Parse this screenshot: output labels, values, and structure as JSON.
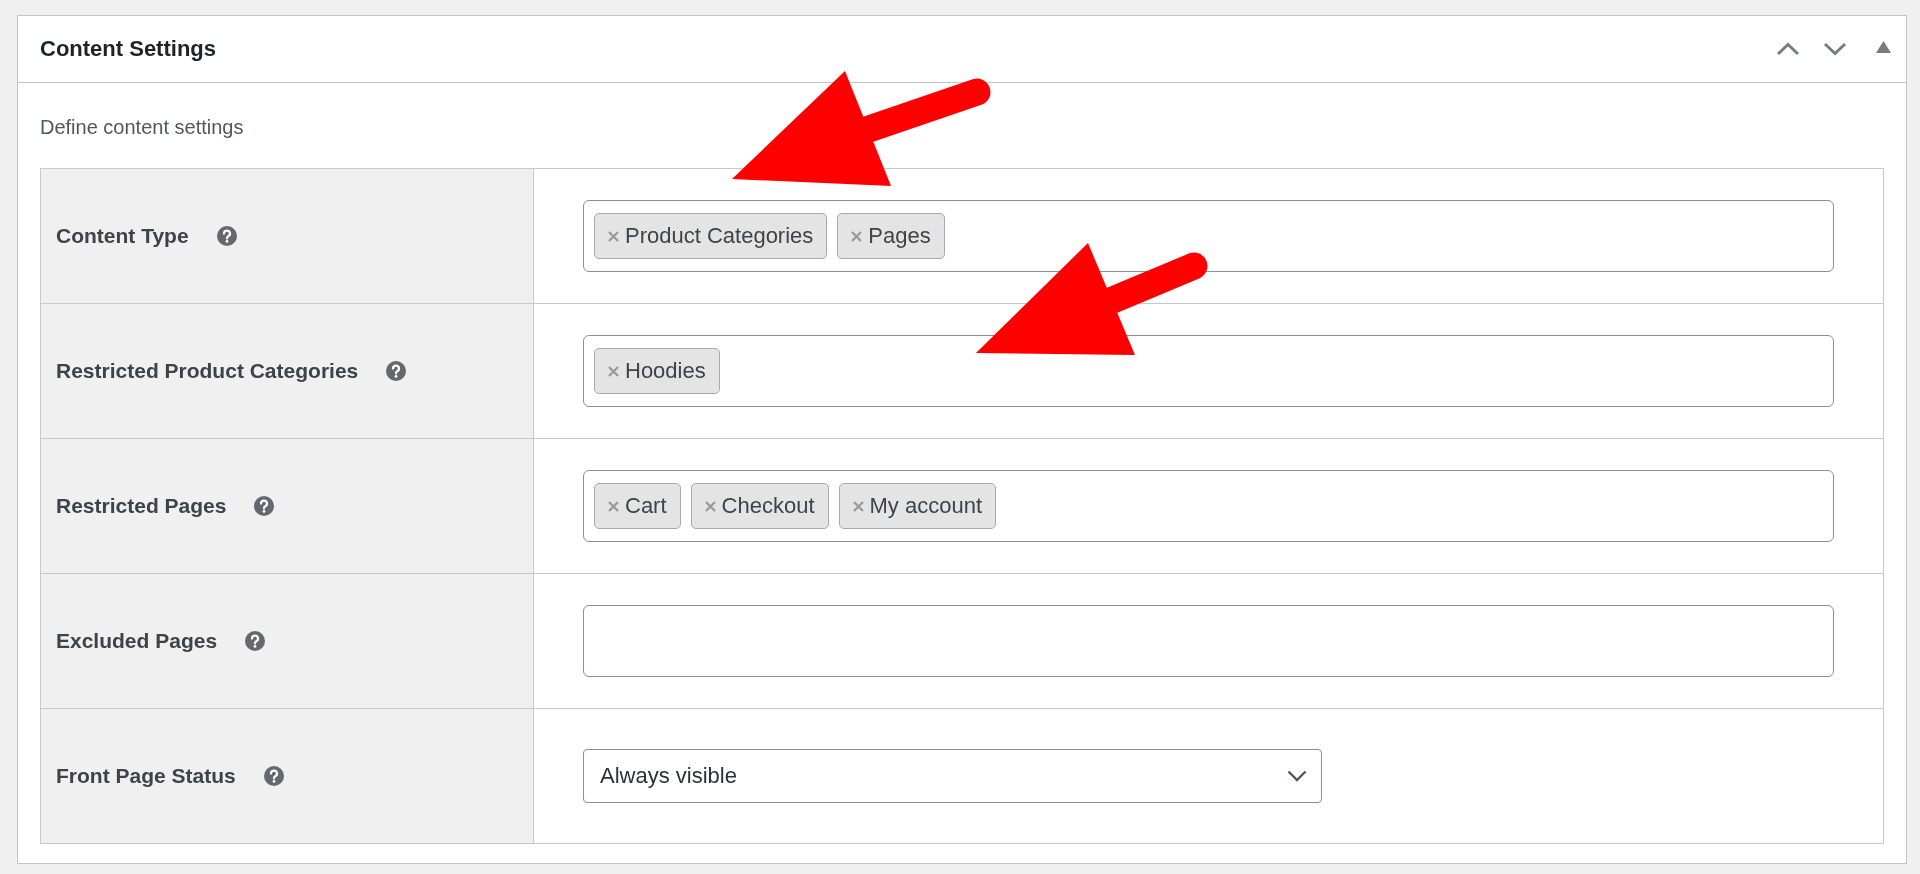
{
  "panel": {
    "title": "Content Settings",
    "description": "Define content settings"
  },
  "settings": [
    {
      "label": "Content Type",
      "kind": "tags",
      "tags": [
        "Product Categories",
        "Pages"
      ]
    },
    {
      "label": "Restricted Product Categories",
      "kind": "tags",
      "tags": [
        "Hoodies"
      ]
    },
    {
      "label": "Restricted Pages",
      "kind": "tags",
      "tags": [
        "Cart",
        "Checkout",
        "My account"
      ]
    },
    {
      "label": "Excluded Pages",
      "kind": "tags"
    },
    {
      "label": "Front Page Status",
      "kind": "select",
      "value": "Always visible"
    }
  ]
}
